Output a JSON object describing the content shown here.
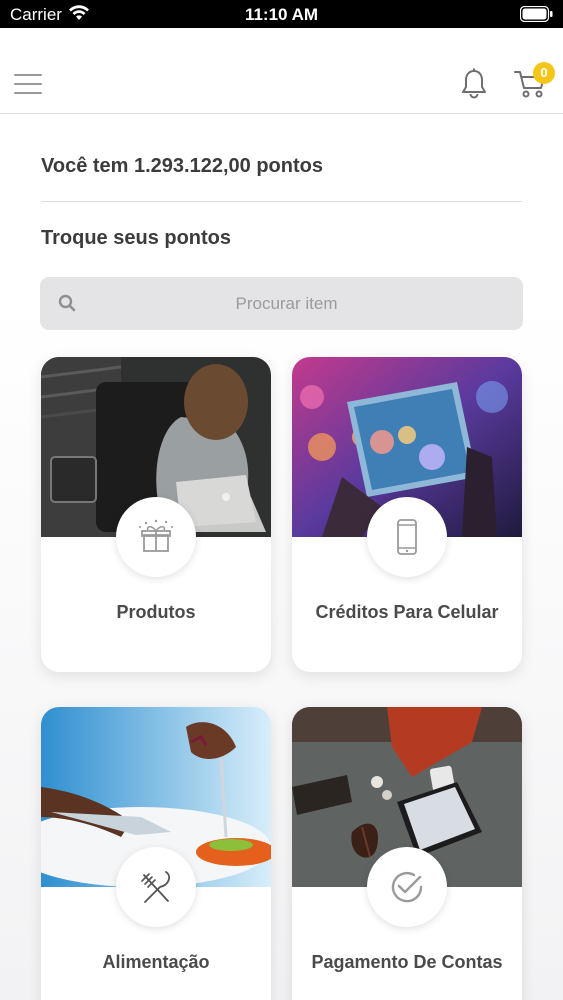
{
  "status_bar": {
    "carrier": "Carrier",
    "time": "11:10 AM"
  },
  "nav": {
    "menu_icon": "hamburger-menu-icon",
    "notifications_icon": "bell-icon",
    "cart_icon": "shopping-cart-icon",
    "cart_count": "0"
  },
  "main": {
    "points_text": "Você tem 1.293.122,00 pontos",
    "section_title": "Troque seus pontos",
    "search": {
      "placeholder": "Procurar item",
      "value": ""
    },
    "categories": [
      {
        "label": "Produtos",
        "icon": "gift-box-icon"
      },
      {
        "label": "Créditos Para Celular",
        "icon": "smartphone-icon"
      },
      {
        "label": "Alimentação",
        "icon": "fork-knife-icon"
      },
      {
        "label": "Pagamento De Contas",
        "icon": "check-circle-icon"
      }
    ]
  },
  "colors": {
    "badge": "#f5c518",
    "text_dark": "#3c3c3c",
    "search_bg": "#e4e4e6",
    "icon_gray": "#9a9a9a"
  }
}
